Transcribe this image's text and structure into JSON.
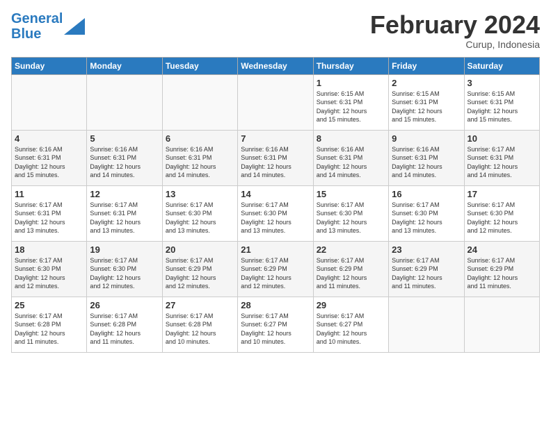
{
  "logo": {
    "line1": "General",
    "line2": "Blue"
  },
  "title": "February 2024",
  "subtitle": "Curup, Indonesia",
  "header_days": [
    "Sunday",
    "Monday",
    "Tuesday",
    "Wednesday",
    "Thursday",
    "Friday",
    "Saturday"
  ],
  "weeks": [
    [
      {
        "day": "",
        "info": ""
      },
      {
        "day": "",
        "info": ""
      },
      {
        "day": "",
        "info": ""
      },
      {
        "day": "",
        "info": ""
      },
      {
        "day": "1",
        "info": "Sunrise: 6:15 AM\nSunset: 6:31 PM\nDaylight: 12 hours\nand 15 minutes."
      },
      {
        "day": "2",
        "info": "Sunrise: 6:15 AM\nSunset: 6:31 PM\nDaylight: 12 hours\nand 15 minutes."
      },
      {
        "day": "3",
        "info": "Sunrise: 6:15 AM\nSunset: 6:31 PM\nDaylight: 12 hours\nand 15 minutes."
      }
    ],
    [
      {
        "day": "4",
        "info": "Sunrise: 6:16 AM\nSunset: 6:31 PM\nDaylight: 12 hours\nand 15 minutes."
      },
      {
        "day": "5",
        "info": "Sunrise: 6:16 AM\nSunset: 6:31 PM\nDaylight: 12 hours\nand 14 minutes."
      },
      {
        "day": "6",
        "info": "Sunrise: 6:16 AM\nSunset: 6:31 PM\nDaylight: 12 hours\nand 14 minutes."
      },
      {
        "day": "7",
        "info": "Sunrise: 6:16 AM\nSunset: 6:31 PM\nDaylight: 12 hours\nand 14 minutes."
      },
      {
        "day": "8",
        "info": "Sunrise: 6:16 AM\nSunset: 6:31 PM\nDaylight: 12 hours\nand 14 minutes."
      },
      {
        "day": "9",
        "info": "Sunrise: 6:16 AM\nSunset: 6:31 PM\nDaylight: 12 hours\nand 14 minutes."
      },
      {
        "day": "10",
        "info": "Sunrise: 6:17 AM\nSunset: 6:31 PM\nDaylight: 12 hours\nand 14 minutes."
      }
    ],
    [
      {
        "day": "11",
        "info": "Sunrise: 6:17 AM\nSunset: 6:31 PM\nDaylight: 12 hours\nand 13 minutes."
      },
      {
        "day": "12",
        "info": "Sunrise: 6:17 AM\nSunset: 6:31 PM\nDaylight: 12 hours\nand 13 minutes."
      },
      {
        "day": "13",
        "info": "Sunrise: 6:17 AM\nSunset: 6:30 PM\nDaylight: 12 hours\nand 13 minutes."
      },
      {
        "day": "14",
        "info": "Sunrise: 6:17 AM\nSunset: 6:30 PM\nDaylight: 12 hours\nand 13 minutes."
      },
      {
        "day": "15",
        "info": "Sunrise: 6:17 AM\nSunset: 6:30 PM\nDaylight: 12 hours\nand 13 minutes."
      },
      {
        "day": "16",
        "info": "Sunrise: 6:17 AM\nSunset: 6:30 PM\nDaylight: 12 hours\nand 13 minutes."
      },
      {
        "day": "17",
        "info": "Sunrise: 6:17 AM\nSunset: 6:30 PM\nDaylight: 12 hours\nand 12 minutes."
      }
    ],
    [
      {
        "day": "18",
        "info": "Sunrise: 6:17 AM\nSunset: 6:30 PM\nDaylight: 12 hours\nand 12 minutes."
      },
      {
        "day": "19",
        "info": "Sunrise: 6:17 AM\nSunset: 6:30 PM\nDaylight: 12 hours\nand 12 minutes."
      },
      {
        "day": "20",
        "info": "Sunrise: 6:17 AM\nSunset: 6:29 PM\nDaylight: 12 hours\nand 12 minutes."
      },
      {
        "day": "21",
        "info": "Sunrise: 6:17 AM\nSunset: 6:29 PM\nDaylight: 12 hours\nand 12 minutes."
      },
      {
        "day": "22",
        "info": "Sunrise: 6:17 AM\nSunset: 6:29 PM\nDaylight: 12 hours\nand 11 minutes."
      },
      {
        "day": "23",
        "info": "Sunrise: 6:17 AM\nSunset: 6:29 PM\nDaylight: 12 hours\nand 11 minutes."
      },
      {
        "day": "24",
        "info": "Sunrise: 6:17 AM\nSunset: 6:29 PM\nDaylight: 12 hours\nand 11 minutes."
      }
    ],
    [
      {
        "day": "25",
        "info": "Sunrise: 6:17 AM\nSunset: 6:28 PM\nDaylight: 12 hours\nand 11 minutes."
      },
      {
        "day": "26",
        "info": "Sunrise: 6:17 AM\nSunset: 6:28 PM\nDaylight: 12 hours\nand 11 minutes."
      },
      {
        "day": "27",
        "info": "Sunrise: 6:17 AM\nSunset: 6:28 PM\nDaylight: 12 hours\nand 10 minutes."
      },
      {
        "day": "28",
        "info": "Sunrise: 6:17 AM\nSunset: 6:27 PM\nDaylight: 12 hours\nand 10 minutes."
      },
      {
        "day": "29",
        "info": "Sunrise: 6:17 AM\nSunset: 6:27 PM\nDaylight: 12 hours\nand 10 minutes."
      },
      {
        "day": "",
        "info": ""
      },
      {
        "day": "",
        "info": ""
      }
    ]
  ]
}
